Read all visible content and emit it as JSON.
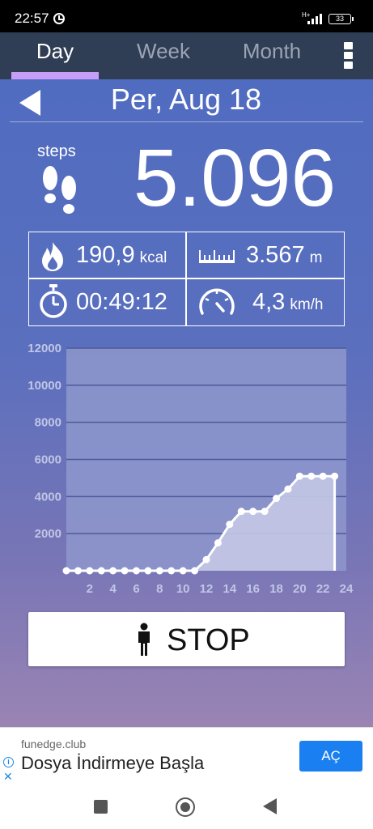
{
  "status_bar": {
    "time": "22:57",
    "network": "H+",
    "battery": "33"
  },
  "tabs": [
    {
      "label": "Day",
      "active": true
    },
    {
      "label": "Week",
      "active": false
    },
    {
      "label": "Month",
      "active": false
    }
  ],
  "date": "Per, Aug 18",
  "steps": {
    "label": "steps",
    "value": "5.096"
  },
  "stats": {
    "calories": {
      "value": "190,9",
      "unit": "kcal"
    },
    "distance": {
      "value": "3.567",
      "unit": "m"
    },
    "duration": {
      "value": "00:49:12"
    },
    "speed": {
      "value": "4,3",
      "unit": "km/h"
    }
  },
  "chart_data": {
    "type": "area",
    "x": [
      0,
      1,
      2,
      3,
      4,
      5,
      6,
      7,
      8,
      9,
      10,
      11,
      12,
      13,
      14,
      15,
      16,
      17,
      18,
      19,
      20,
      21,
      22,
      23
    ],
    "y": [
      0,
      0,
      0,
      0,
      0,
      0,
      0,
      0,
      0,
      0,
      0,
      0,
      600,
      1500,
      2500,
      3200,
      3200,
      3200,
      3900,
      4400,
      5096,
      5096,
      5096,
      5096
    ],
    "xlim": [
      0,
      24
    ],
    "ylim": [
      0,
      12000
    ],
    "x_ticks": [
      "2",
      "4",
      "6",
      "8",
      "10",
      "12",
      "14",
      "16",
      "18",
      "20",
      "22",
      "24"
    ],
    "y_ticks": [
      "2000",
      "4000",
      "6000",
      "8000",
      "10000",
      "12000"
    ],
    "grid": true,
    "colors": {
      "fill": "#c4c8e4",
      "line": "#ffffff",
      "plot_bg": "#8e98cc",
      "grid": "#4e5a99",
      "tick_label": "#c0c6e6"
    }
  },
  "stop_button": {
    "label": "STOP"
  },
  "ad": {
    "source": "funedge.club",
    "headline": "Dosya İndirmeye Başla",
    "button": "AÇ"
  }
}
